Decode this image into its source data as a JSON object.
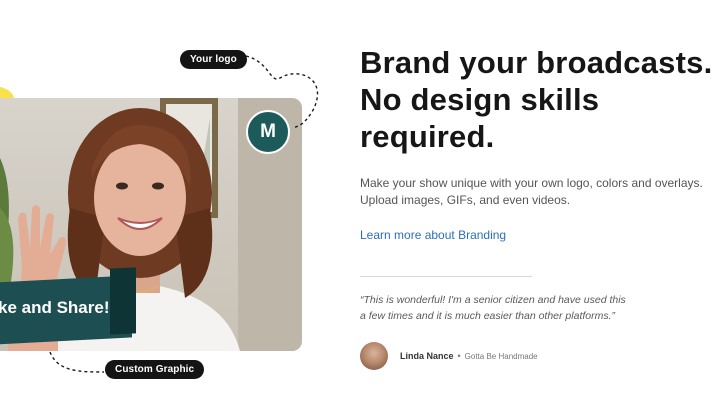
{
  "visual": {
    "logo_pill": "Your logo",
    "avatar_letter": "M",
    "banner_text": "ke and Share!",
    "graphic_pill": "Custom Graphic"
  },
  "content": {
    "headline_line1": "Brand your broadcasts.",
    "headline_line2": "No design skills",
    "headline_line3": "required.",
    "description_line1": "Make your show unique with your own logo, colors and overlays.",
    "description_line2": "Upload images, GIFs, and even videos.",
    "learn_more_link": "Learn more about Branding",
    "testimonial_quote": "“This is wonderful! I'm a senior citizen and have used this a few times and it is much easier than other platforms.”",
    "author_name": "Linda Nance",
    "author_separator": "•",
    "author_company": "Gotta Be Handmade"
  },
  "colors": {
    "accent_teal": "#1d5a5a",
    "banner_teal": "#1d4f52",
    "link_blue": "#2e6fb8",
    "yellow": "#f7e24a"
  }
}
